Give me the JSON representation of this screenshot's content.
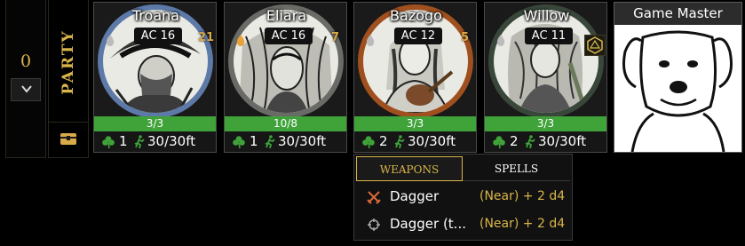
{
  "counter": {
    "value": "0"
  },
  "party": {
    "label": "PARTY"
  },
  "characters": [
    {
      "name": "Troana",
      "ac": "AC 16",
      "initiative": "21",
      "hp": "3/3",
      "actions": "1",
      "speed": "30/30ft"
    },
    {
      "name": "Eliara",
      "ac": "AC 16",
      "initiative": "7",
      "hp": "10/8",
      "actions": "1",
      "speed": "30/30ft"
    },
    {
      "name": "Bazogo",
      "ac": "AC 12",
      "initiative": "5",
      "hp": "3/3",
      "actions": "2",
      "speed": "30/30ft"
    },
    {
      "name": "Willow",
      "ac": "AC 11",
      "initiative": "",
      "hp": "3/3",
      "actions": "2",
      "speed": "30/30ft"
    }
  ],
  "game_master": {
    "title": "Game Master"
  },
  "popup": {
    "tabs": [
      {
        "label": "WEAPONS",
        "active": true
      },
      {
        "label": "SPELLS",
        "active": false
      }
    ],
    "weapons": [
      {
        "name": "Dagger",
        "icon": "crossed-swords-icon",
        "stat": "(Near) + 2 d4"
      },
      {
        "name": "Dagger (t...",
        "icon": "crosshair-icon",
        "stat": "(Near) + 2 d4"
      }
    ]
  },
  "colors": {
    "accent": "#d9b54a",
    "hp_green": "#3fa33a",
    "clover_green": "#3fa33a"
  }
}
